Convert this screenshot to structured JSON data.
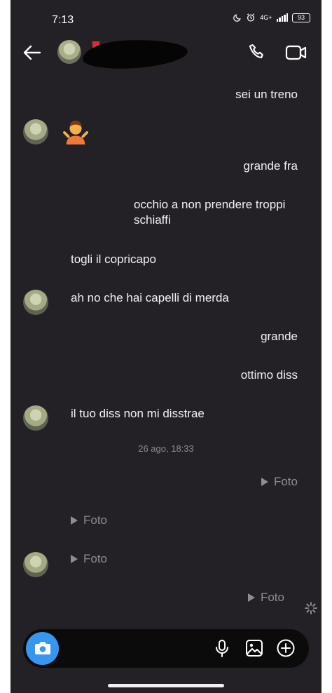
{
  "status": {
    "time": "7:13",
    "network": "4G+",
    "battery": "93"
  },
  "header": {
    "icons": [
      "back-arrow-icon",
      "phone-icon",
      "video-camera-icon"
    ]
  },
  "messages": [
    {
      "side": "out",
      "text": "sei un treno"
    },
    {
      "side": "in",
      "emoji": "person-shrugging-emoji"
    },
    {
      "side": "out",
      "text": "grande fra"
    },
    {
      "side": "out",
      "text": "occhio a non prendere troppi\nschiaffi"
    },
    {
      "side": "in",
      "text": "togli il copricapo"
    },
    {
      "side": "in",
      "text": "ah no che hai capelli di merda"
    },
    {
      "side": "out",
      "text": "grande"
    },
    {
      "side": "out",
      "text": "ottimo diss"
    },
    {
      "side": "in",
      "text": "il tuo diss non mi disstrae"
    }
  ],
  "timestamp": "26 ago, 18:33",
  "media": [
    {
      "side": "out",
      "label": "Foto"
    },
    {
      "side": "in",
      "label": "Foto"
    },
    {
      "side": "in",
      "label": "Foto"
    },
    {
      "side": "out",
      "label": "Foto"
    }
  ],
  "composer": {
    "icons": [
      "camera-icon",
      "microphone-icon",
      "gallery-icon",
      "plus-icon"
    ]
  },
  "colors": {
    "background": "#232126",
    "accent": "#3797f0",
    "muted": "#8f8d93"
  }
}
